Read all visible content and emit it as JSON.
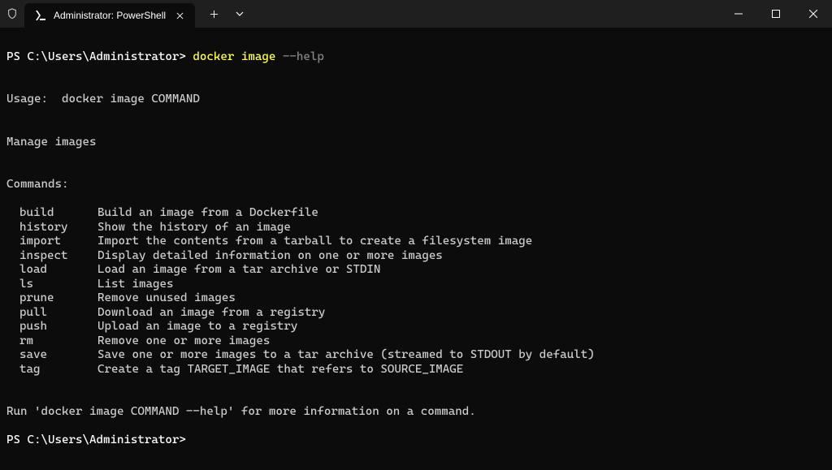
{
  "titlebar": {
    "tab_title": "Administrator: PowerShell"
  },
  "terminal": {
    "prompt1": "PS C:\\Users\\Administrator> ",
    "command1": "docker image ",
    "flag1": "--help",
    "blank1": "",
    "usage": "Usage:  docker image COMMAND",
    "blank2": "",
    "description": "Manage images",
    "blank3": "",
    "commands_header": "Commands:",
    "commands": [
      {
        "name": "build",
        "desc": "Build an image from a Dockerfile"
      },
      {
        "name": "history",
        "desc": "Show the history of an image"
      },
      {
        "name": "import",
        "desc": "Import the contents from a tarball to create a filesystem image"
      },
      {
        "name": "inspect",
        "desc": "Display detailed information on one or more images"
      },
      {
        "name": "load",
        "desc": "Load an image from a tar archive or STDIN"
      },
      {
        "name": "ls",
        "desc": "List images"
      },
      {
        "name": "prune",
        "desc": "Remove unused images"
      },
      {
        "name": "pull",
        "desc": "Download an image from a registry"
      },
      {
        "name": "push",
        "desc": "Upload an image to a registry"
      },
      {
        "name": "rm",
        "desc": "Remove one or more images"
      },
      {
        "name": "save",
        "desc": "Save one or more images to a tar archive (streamed to STDOUT by default)"
      },
      {
        "name": "tag",
        "desc": "Create a tag TARGET_IMAGE that refers to SOURCE_IMAGE"
      }
    ],
    "blank4": "",
    "footer": "Run 'docker image COMMAND --help' for more information on a command.",
    "prompt2": "PS C:\\Users\\Administrator>"
  }
}
